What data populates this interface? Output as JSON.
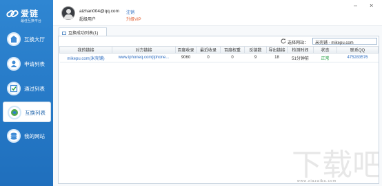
{
  "app": {
    "title": "爱链",
    "subtitle": "最佳互换平台"
  },
  "window_controls": {
    "minimize": "–",
    "close": "×"
  },
  "user": {
    "email": "aizhan004@qq.com",
    "level": "超级用户",
    "logout_label": "注销",
    "upgrade_label": "升级VIP"
  },
  "sidebar": {
    "items": [
      {
        "label": "互换大厅",
        "icon": "hall-icon",
        "active": false
      },
      {
        "label": "申请列表",
        "icon": "apply-list-icon",
        "active": false
      },
      {
        "label": "通过列表",
        "icon": "approved-list-icon",
        "active": false
      },
      {
        "label": "互换列表",
        "icon": "exchange-list-icon",
        "active": true
      },
      {
        "label": "我的网站",
        "icon": "my-site-icon",
        "active": false
      }
    ]
  },
  "tab": {
    "label": "互换成功列表(1)"
  },
  "search": {
    "label": "选择网站：",
    "value": "米壳铺 - mikepu.com"
  },
  "table": {
    "headers": [
      "我的链接",
      "对方链接",
      "百度收录",
      "最近收录",
      "百度权重",
      "反链数",
      "导出链接",
      "检测时间",
      "状态",
      "联系QQ"
    ],
    "rows": [
      [
        "mikepu.com(米壳铺)",
        "www.iphoneq.com(iphone...",
        "9060",
        "0",
        "0",
        "9",
        "18",
        "51分钟前",
        "正常",
        "475283576"
      ]
    ]
  },
  "watermark": {
    "text": "www.xiazaiba.com"
  },
  "colors": {
    "sidebar": "#2479c6",
    "link": "#2a6bc0",
    "status_ok": "#1c9d3e",
    "arrow": "#d9302a"
  }
}
